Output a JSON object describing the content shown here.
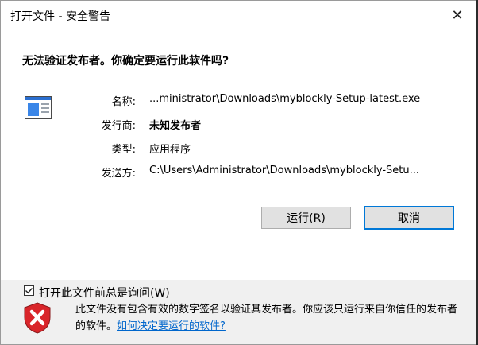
{
  "dialog": {
    "title": "打开文件 - 安全警告",
    "close_symbol": "✕",
    "headline": "无法验证发布者。你确定要运行此软件吗?",
    "icons": {
      "file": "application-file-icon",
      "shield": "warning-shield-icon",
      "close": "close-icon"
    },
    "fields": [
      {
        "label": "名称:",
        "value": "...ministrator\\Downloads\\myblockly-Setup-latest.exe"
      },
      {
        "label": "发行商:",
        "value": "未知发布者"
      },
      {
        "label": "类型:",
        "value": "应用程序"
      },
      {
        "label": "发送方:",
        "value": "C:\\Users\\Administrator\\Downloads\\myblockly-Setu..."
      }
    ],
    "buttons": {
      "run": "运行(R)",
      "cancel": "取消"
    },
    "checkbox": {
      "label": "打开此文件前总是询问(W)",
      "checked": true
    },
    "warning": {
      "text": "此文件没有包含有效的数字签名以验证其发布者。你应该只运行来自你信任的发布者的软件。",
      "link": "如何决定要运行的软件?"
    },
    "colors": {
      "accent": "#0078d7",
      "link": "#0066cc",
      "shield_red": "#d9252a"
    }
  }
}
